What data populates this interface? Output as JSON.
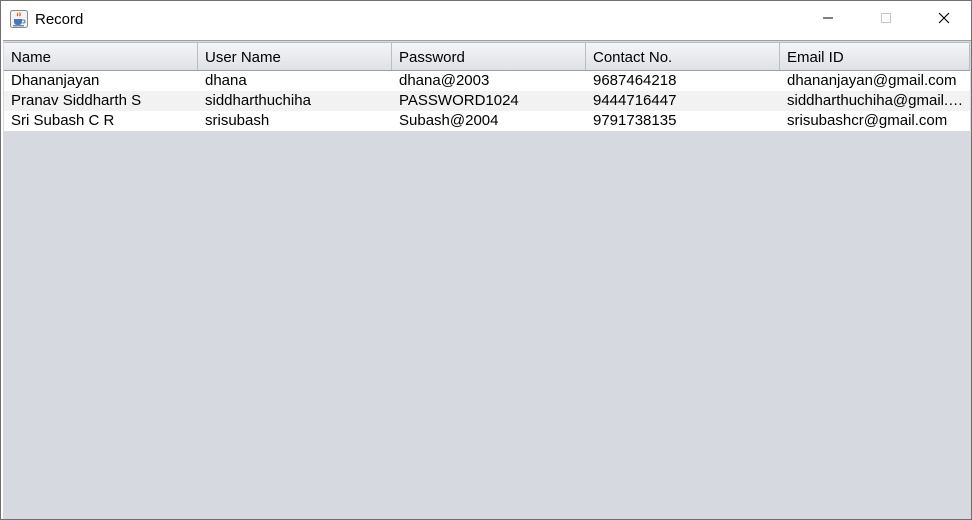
{
  "window": {
    "title": "Record",
    "icon": "java-cup-icon"
  },
  "controls": {
    "minimize": "minimize-icon",
    "maximize": "maximize-icon",
    "close": "close-icon"
  },
  "table": {
    "columns": [
      "Name",
      "User Name",
      "Password",
      "Contact No.",
      "Email ID"
    ],
    "rows": [
      [
        "Dhananjayan",
        "dhana",
        "dhana@2003",
        "9687464218",
        "dhananjayan@gmail.com"
      ],
      [
        "Pranav Siddharth S",
        "siddharthuchiha",
        "PASSWORD1024",
        "9444716447",
        "siddharthuchiha@gmail.co..."
      ],
      [
        "Sri Subash C R",
        "srisubash",
        "Subash@2004",
        "9791738135",
        "srisubashcr@gmail.com"
      ]
    ]
  },
  "colors": {
    "empty_area": "#d6d9df",
    "row_alt": "#f2f2f2"
  }
}
